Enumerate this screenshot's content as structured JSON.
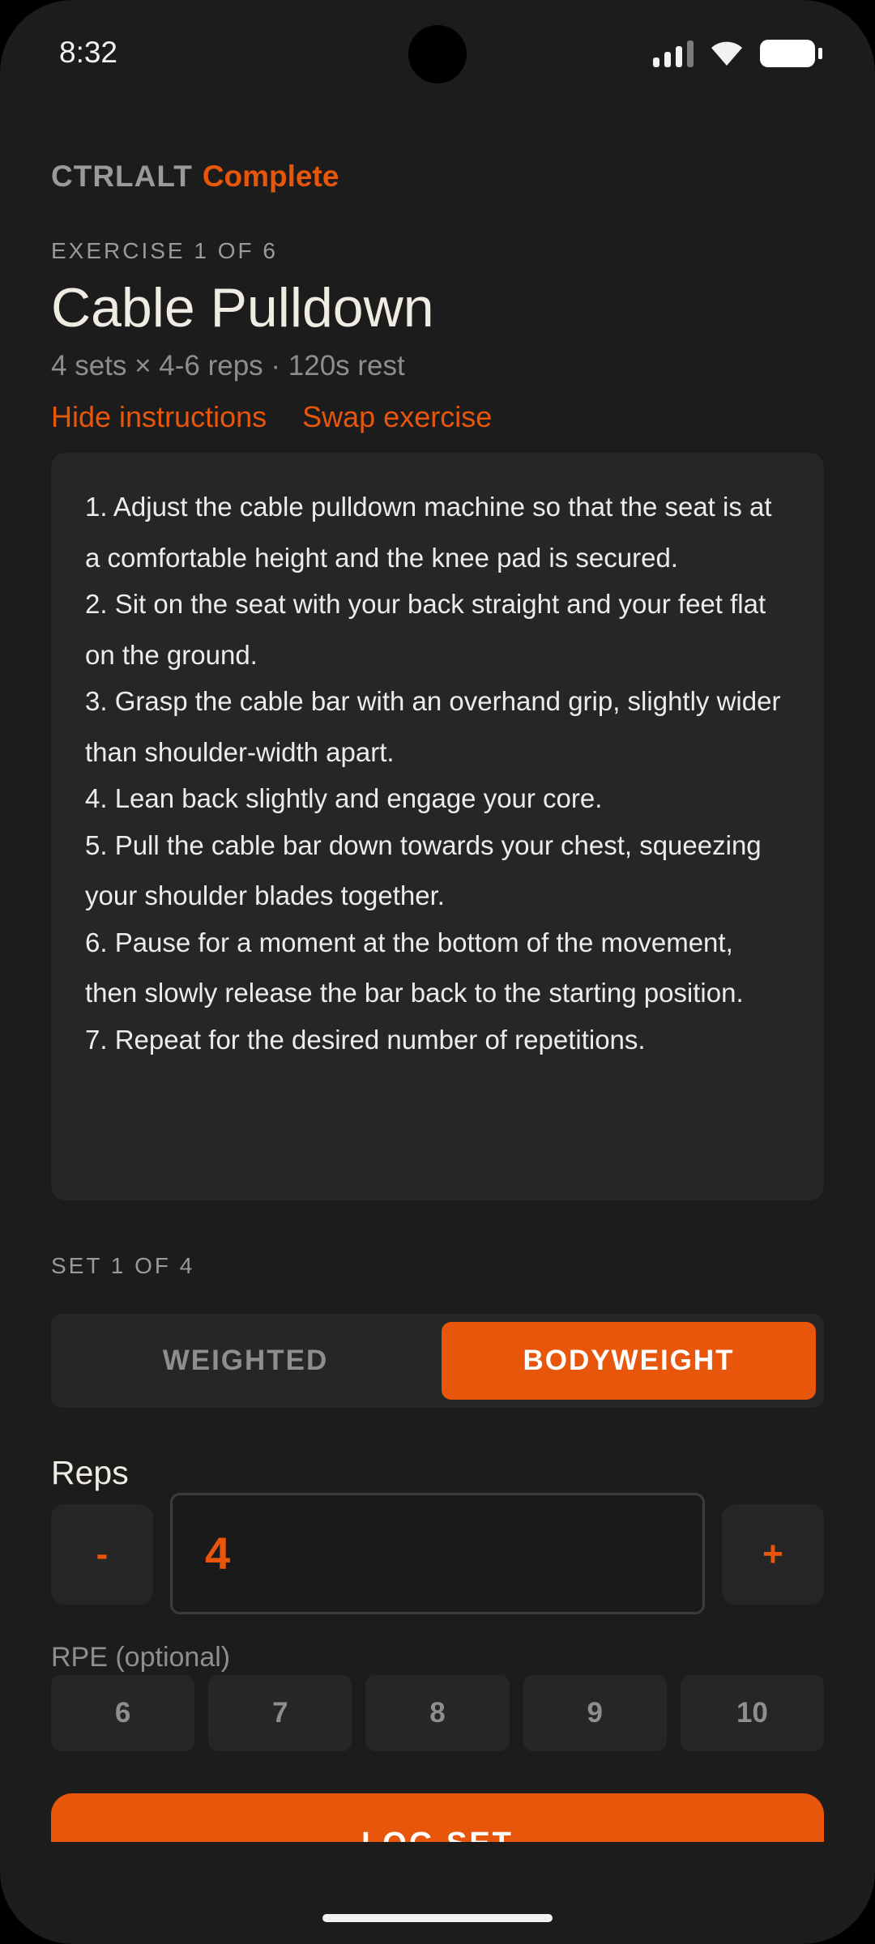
{
  "status_bar": {
    "time": "8:32",
    "icons": [
      "signal-icon",
      "wifi-icon",
      "battery-icon"
    ]
  },
  "brand": {
    "name": "CTRLALT",
    "suffix": "Complete"
  },
  "exercise": {
    "counter": "EXERCISE 1 OF 6",
    "title": "Cable Pulldown",
    "details": "4 sets × 4-6 reps · 120s rest",
    "hide_instructions_label": "Hide instructions",
    "swap_exercise_label": "Swap exercise",
    "instructions": [
      "1. Adjust the cable pulldown machine so that the seat is at a comfortable height and the knee pad is secured.",
      "2. Sit on the seat with your back straight and your feet flat on the ground.",
      "3. Grasp the cable bar with an overhand grip, slightly wider than shoulder-width apart.",
      "4. Lean back slightly and engage your core.",
      "5. Pull the cable bar down towards your chest, squeezing your shoulder blades together.",
      "6. Pause for a moment at the bottom of the movement, then slowly release the bar back to the starting position.",
      "7. Repeat for the desired number of repetitions."
    ]
  },
  "set": {
    "counter": "SET 1 OF 4",
    "mode_options": [
      "WEIGHTED",
      "BODYWEIGHT"
    ],
    "mode_selected": "BODYWEIGHT",
    "reps_label": "Reps",
    "reps_value": "4",
    "decrement_label": "-",
    "increment_label": "+",
    "rpe_label": "RPE (optional)",
    "rpe_options": [
      "6",
      "7",
      "8",
      "9",
      "10"
    ],
    "log_label": "LOG SET"
  },
  "colors": {
    "accent": "#e8560c",
    "background": "#1c1c1c",
    "surface": "#262626",
    "text_primary": "#f0ece4",
    "text_secondary": "#8e8e8e"
  }
}
